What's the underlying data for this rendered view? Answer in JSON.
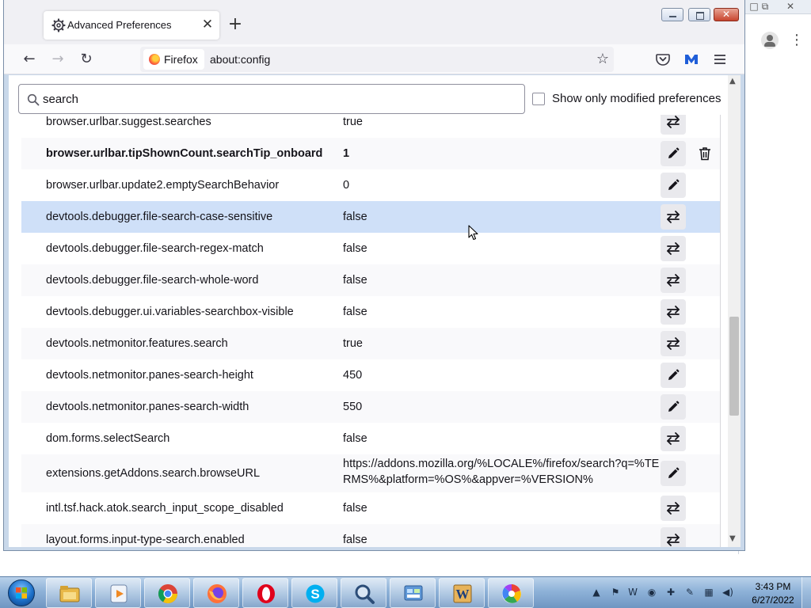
{
  "browser": {
    "tab": {
      "title": "Advanced Preferences",
      "close_glyph": "✕",
      "icon": "gear-icon"
    },
    "new_tab_glyph": "+",
    "nav": {
      "back_glyph": "←",
      "forward_glyph": "→",
      "reload_glyph": "↻",
      "bookmark_glyph": "☆"
    },
    "identity_label": "Firefox",
    "url": "about:config"
  },
  "background_window": {
    "controls": [
      "□",
      "⧉",
      "✕"
    ],
    "kebab": "⋮"
  },
  "config": {
    "search_value": "search",
    "show_modified_label": "Show only modified preferences",
    "rows": [
      {
        "name": "browser.urlbar.suggest.searches",
        "value": "true",
        "action": "toggle",
        "modified": false
      },
      {
        "name": "browser.urlbar.tipShownCount.searchTip_onboard",
        "value": "1",
        "action": "edit",
        "modified": true
      },
      {
        "name": "browser.urlbar.update2.emptySearchBehavior",
        "value": "0",
        "action": "edit",
        "modified": false
      },
      {
        "name": "devtools.debugger.file-search-case-sensitive",
        "value": "false",
        "action": "toggle",
        "modified": false,
        "selected": true
      },
      {
        "name": "devtools.debugger.file-search-regex-match",
        "value": "false",
        "action": "toggle",
        "modified": false
      },
      {
        "name": "devtools.debugger.file-search-whole-word",
        "value": "false",
        "action": "toggle",
        "modified": false
      },
      {
        "name": "devtools.debugger.ui.variables-searchbox-visible",
        "value": "false",
        "action": "toggle",
        "modified": false
      },
      {
        "name": "devtools.netmonitor.features.search",
        "value": "true",
        "action": "toggle",
        "modified": false
      },
      {
        "name": "devtools.netmonitor.panes-search-height",
        "value": "450",
        "action": "edit",
        "modified": false
      },
      {
        "name": "devtools.netmonitor.panes-search-width",
        "value": "550",
        "action": "edit",
        "modified": false
      },
      {
        "name": "dom.forms.selectSearch",
        "value": "false",
        "action": "toggle",
        "modified": false
      },
      {
        "name": "extensions.getAddons.search.browseURL",
        "value": "https://addons.mozilla.org/%LOCALE%/firefox/search?q=%TERMS%&platform=%OS%&appver=%VERSION%",
        "action": "edit",
        "modified": false,
        "multiline": true
      },
      {
        "name": "intl.tsf.hack.atok.search_input_scope_disabled",
        "value": "false",
        "action": "toggle",
        "modified": false
      },
      {
        "name": "layout.forms.input-type-search.enabled",
        "value": "false",
        "action": "toggle",
        "modified": false
      }
    ]
  },
  "taskbar": {
    "items": [
      "file-explorer-icon",
      "media-player-icon",
      "chrome-icon",
      "firefox-icon",
      "opera-icon",
      "skype-icon",
      "search-app-icon",
      "control-panel-icon",
      "word-icon",
      "picasa-icon"
    ],
    "tray_icons": [
      "▲",
      "⚑",
      "W",
      "◉",
      "✚",
      "✎",
      "▦",
      "◀)"
    ],
    "clock_time": "3:43 PM",
    "clock_date": "6/27/2022"
  },
  "colors": {
    "selected_row": "#cfe0f8",
    "taskbar": "#8eb2d8",
    "close_button": "#c8452e"
  }
}
